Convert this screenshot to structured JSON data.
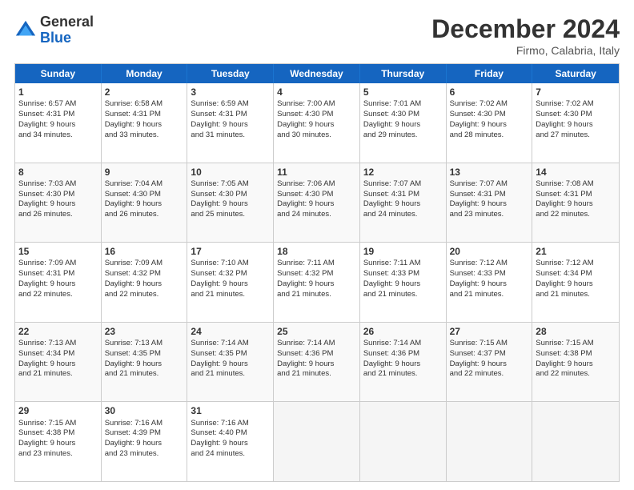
{
  "logo": {
    "general": "General",
    "blue": "Blue"
  },
  "header": {
    "title": "December 2024",
    "subtitle": "Firmo, Calabria, Italy"
  },
  "weekdays": [
    "Sunday",
    "Monday",
    "Tuesday",
    "Wednesday",
    "Thursday",
    "Friday",
    "Saturday"
  ],
  "weeks": [
    [
      {
        "day": "1",
        "lines": [
          "Sunrise: 6:57 AM",
          "Sunset: 4:31 PM",
          "Daylight: 9 hours",
          "and 34 minutes."
        ]
      },
      {
        "day": "2",
        "lines": [
          "Sunrise: 6:58 AM",
          "Sunset: 4:31 PM",
          "Daylight: 9 hours",
          "and 33 minutes."
        ]
      },
      {
        "day": "3",
        "lines": [
          "Sunrise: 6:59 AM",
          "Sunset: 4:31 PM",
          "Daylight: 9 hours",
          "and 31 minutes."
        ]
      },
      {
        "day": "4",
        "lines": [
          "Sunrise: 7:00 AM",
          "Sunset: 4:30 PM",
          "Daylight: 9 hours",
          "and 30 minutes."
        ]
      },
      {
        "day": "5",
        "lines": [
          "Sunrise: 7:01 AM",
          "Sunset: 4:30 PM",
          "Daylight: 9 hours",
          "and 29 minutes."
        ]
      },
      {
        "day": "6",
        "lines": [
          "Sunrise: 7:02 AM",
          "Sunset: 4:30 PM",
          "Daylight: 9 hours",
          "and 28 minutes."
        ]
      },
      {
        "day": "7",
        "lines": [
          "Sunrise: 7:02 AM",
          "Sunset: 4:30 PM",
          "Daylight: 9 hours",
          "and 27 minutes."
        ]
      }
    ],
    [
      {
        "day": "8",
        "lines": [
          "Sunrise: 7:03 AM",
          "Sunset: 4:30 PM",
          "Daylight: 9 hours",
          "and 26 minutes."
        ]
      },
      {
        "day": "9",
        "lines": [
          "Sunrise: 7:04 AM",
          "Sunset: 4:30 PM",
          "Daylight: 9 hours",
          "and 26 minutes."
        ]
      },
      {
        "day": "10",
        "lines": [
          "Sunrise: 7:05 AM",
          "Sunset: 4:30 PM",
          "Daylight: 9 hours",
          "and 25 minutes."
        ]
      },
      {
        "day": "11",
        "lines": [
          "Sunrise: 7:06 AM",
          "Sunset: 4:30 PM",
          "Daylight: 9 hours",
          "and 24 minutes."
        ]
      },
      {
        "day": "12",
        "lines": [
          "Sunrise: 7:07 AM",
          "Sunset: 4:31 PM",
          "Daylight: 9 hours",
          "and 24 minutes."
        ]
      },
      {
        "day": "13",
        "lines": [
          "Sunrise: 7:07 AM",
          "Sunset: 4:31 PM",
          "Daylight: 9 hours",
          "and 23 minutes."
        ]
      },
      {
        "day": "14",
        "lines": [
          "Sunrise: 7:08 AM",
          "Sunset: 4:31 PM",
          "Daylight: 9 hours",
          "and 22 minutes."
        ]
      }
    ],
    [
      {
        "day": "15",
        "lines": [
          "Sunrise: 7:09 AM",
          "Sunset: 4:31 PM",
          "Daylight: 9 hours",
          "and 22 minutes."
        ]
      },
      {
        "day": "16",
        "lines": [
          "Sunrise: 7:09 AM",
          "Sunset: 4:32 PM",
          "Daylight: 9 hours",
          "and 22 minutes."
        ]
      },
      {
        "day": "17",
        "lines": [
          "Sunrise: 7:10 AM",
          "Sunset: 4:32 PM",
          "Daylight: 9 hours",
          "and 21 minutes."
        ]
      },
      {
        "day": "18",
        "lines": [
          "Sunrise: 7:11 AM",
          "Sunset: 4:32 PM",
          "Daylight: 9 hours",
          "and 21 minutes."
        ]
      },
      {
        "day": "19",
        "lines": [
          "Sunrise: 7:11 AM",
          "Sunset: 4:33 PM",
          "Daylight: 9 hours",
          "and 21 minutes."
        ]
      },
      {
        "day": "20",
        "lines": [
          "Sunrise: 7:12 AM",
          "Sunset: 4:33 PM",
          "Daylight: 9 hours",
          "and 21 minutes."
        ]
      },
      {
        "day": "21",
        "lines": [
          "Sunrise: 7:12 AM",
          "Sunset: 4:34 PM",
          "Daylight: 9 hours",
          "and 21 minutes."
        ]
      }
    ],
    [
      {
        "day": "22",
        "lines": [
          "Sunrise: 7:13 AM",
          "Sunset: 4:34 PM",
          "Daylight: 9 hours",
          "and 21 minutes."
        ]
      },
      {
        "day": "23",
        "lines": [
          "Sunrise: 7:13 AM",
          "Sunset: 4:35 PM",
          "Daylight: 9 hours",
          "and 21 minutes."
        ]
      },
      {
        "day": "24",
        "lines": [
          "Sunrise: 7:14 AM",
          "Sunset: 4:35 PM",
          "Daylight: 9 hours",
          "and 21 minutes."
        ]
      },
      {
        "day": "25",
        "lines": [
          "Sunrise: 7:14 AM",
          "Sunset: 4:36 PM",
          "Daylight: 9 hours",
          "and 21 minutes."
        ]
      },
      {
        "day": "26",
        "lines": [
          "Sunrise: 7:14 AM",
          "Sunset: 4:36 PM",
          "Daylight: 9 hours",
          "and 21 minutes."
        ]
      },
      {
        "day": "27",
        "lines": [
          "Sunrise: 7:15 AM",
          "Sunset: 4:37 PM",
          "Daylight: 9 hours",
          "and 22 minutes."
        ]
      },
      {
        "day": "28",
        "lines": [
          "Sunrise: 7:15 AM",
          "Sunset: 4:38 PM",
          "Daylight: 9 hours",
          "and 22 minutes."
        ]
      }
    ],
    [
      {
        "day": "29",
        "lines": [
          "Sunrise: 7:15 AM",
          "Sunset: 4:38 PM",
          "Daylight: 9 hours",
          "and 23 minutes."
        ]
      },
      {
        "day": "30",
        "lines": [
          "Sunrise: 7:16 AM",
          "Sunset: 4:39 PM",
          "Daylight: 9 hours",
          "and 23 minutes."
        ]
      },
      {
        "day": "31",
        "lines": [
          "Sunrise: 7:16 AM",
          "Sunset: 4:40 PM",
          "Daylight: 9 hours",
          "and 24 minutes."
        ]
      },
      null,
      null,
      null,
      null
    ]
  ]
}
